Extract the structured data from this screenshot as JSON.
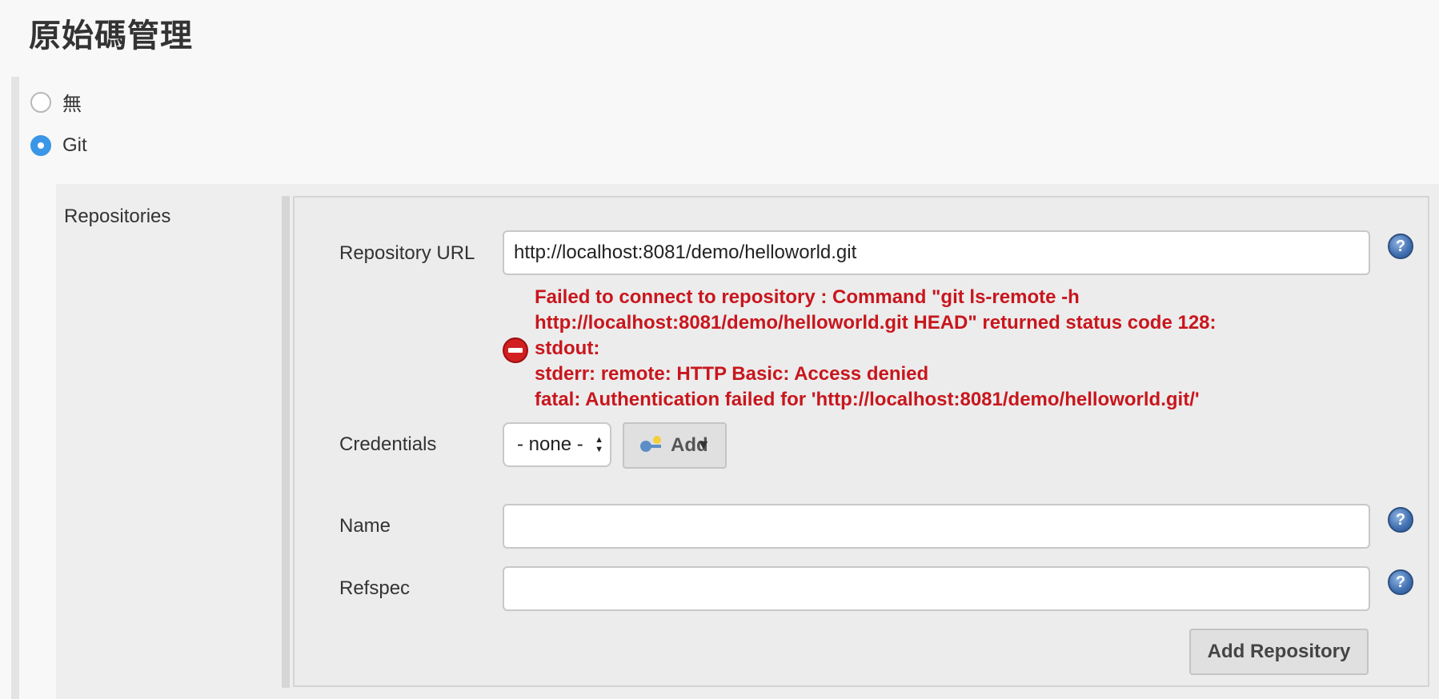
{
  "section": {
    "title": "原始碼管理"
  },
  "scm_options": [
    {
      "label": "無",
      "checked": false
    },
    {
      "label": "Git",
      "checked": true
    }
  ],
  "repositories": {
    "label": "Repositories",
    "repository_url": {
      "label": "Repository URL",
      "value": "http://localhost:8081/demo/helloworld.git"
    },
    "error": {
      "lines": [
        "Failed to connect to repository : Command \"git ls-remote -h",
        "http://localhost:8081/demo/helloworld.git HEAD\" returned status code 128:",
        "stdout:",
        "stderr: remote: HTTP Basic: Access denied",
        "fatal: Authentication failed for 'http://localhost:8081/demo/helloworld.git/'"
      ],
      "color": "#c8161d"
    },
    "credentials": {
      "label": "Credentials",
      "selected": "- none -",
      "add_label": "Add"
    },
    "name": {
      "label": "Name",
      "value": ""
    },
    "refspec": {
      "label": "Refspec",
      "value": ""
    },
    "add_repository_label": "Add Repository"
  },
  "colors": {
    "accent": "#3a96e6",
    "error": "#c8161d",
    "help_icon": "#3f6fb0"
  },
  "icons": {
    "help": "help-icon",
    "error": "error-icon",
    "key": "key-icon"
  }
}
